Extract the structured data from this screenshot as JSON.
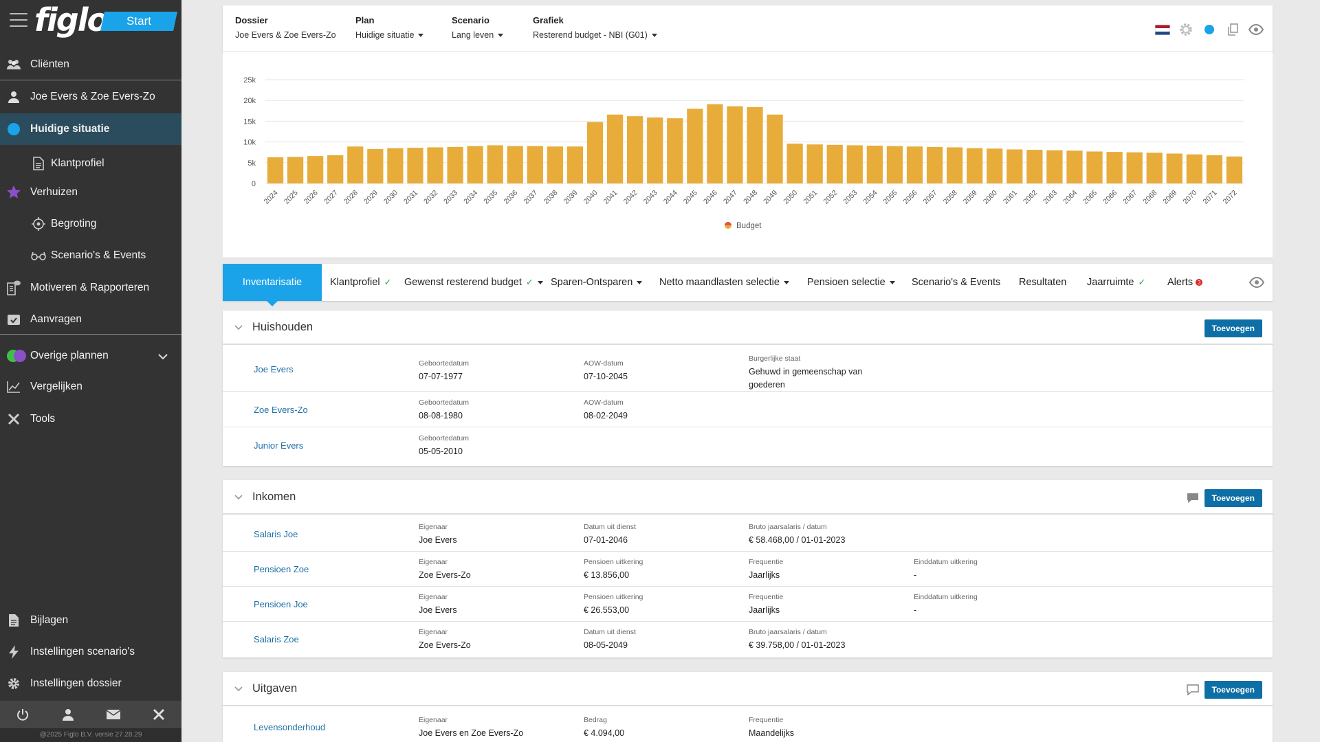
{
  "app": {
    "logo": "figlo",
    "start_label": "Start"
  },
  "sidebar": {
    "items": [
      {
        "label": "Cliënten",
        "icon": "users-icon"
      },
      {
        "label": "Joe Evers & Zoe Evers-Zo",
        "icon": "user-icon"
      },
      {
        "label": "Huidige situatie",
        "icon": "dot-icon"
      },
      {
        "label": "Klantprofiel",
        "icon": "document-icon"
      },
      {
        "label": "Verhuizen",
        "icon": "star-icon"
      },
      {
        "label": "Begroting",
        "icon": "target-icon"
      },
      {
        "label": "Scenario's & Events",
        "icon": "glasses-icon"
      },
      {
        "label": "Motiveren & Rapporteren",
        "icon": "report-icon"
      },
      {
        "label": "Aanvragen",
        "icon": "request-icon"
      },
      {
        "label": "Overige plannen",
        "icon": "plans-icon"
      },
      {
        "label": "Vergelijken",
        "icon": "compare-icon"
      },
      {
        "label": "Tools",
        "icon": "tools-icon"
      },
      {
        "label": "Bijlagen",
        "icon": "attachment-icon"
      },
      {
        "label": "Instellingen scenario's",
        "icon": "bolt-icon"
      },
      {
        "label": "Instellingen dossier",
        "icon": "gear-icon"
      }
    ],
    "copyright": "@2025 Figlo B.V. versie 27.28.29"
  },
  "topbar": {
    "dossier": {
      "label": "Dossier",
      "value": "Joe Evers & Zoe Evers-Zo"
    },
    "plan": {
      "label": "Plan",
      "value": "Huidige situatie"
    },
    "scenario": {
      "label": "Scenario",
      "value": "Lang leven"
    },
    "grafiek": {
      "label": "Grafiek",
      "value": "Resterend budget - NBI (G01)"
    }
  },
  "chart_data": {
    "type": "bar",
    "categories": [
      "2024",
      "2025",
      "2026",
      "2027",
      "2028",
      "2029",
      "2030",
      "2031",
      "2032",
      "2033",
      "2034",
      "2035",
      "2036",
      "2037",
      "2038",
      "2039",
      "2040",
      "2041",
      "2042",
      "2043",
      "2044",
      "2045",
      "2046",
      "2047",
      "2048",
      "2049",
      "2050",
      "2051",
      "2052",
      "2053",
      "2054",
      "2055",
      "2056",
      "2057",
      "2058",
      "2059",
      "2060",
      "2061",
      "2062",
      "2063",
      "2064",
      "2065",
      "2066",
      "2067",
      "2068",
      "2069",
      "2070",
      "2071",
      "2072"
    ],
    "series": [
      {
        "name": "Budget",
        "values": [
          6300,
          6400,
          6600,
          6800,
          8900,
          8300,
          8500,
          8600,
          8700,
          8800,
          9000,
          9200,
          9000,
          9000,
          8900,
          8900,
          14800,
          16600,
          16200,
          15900,
          15700,
          18000,
          19100,
          18600,
          18400,
          16600,
          9600,
          9400,
          9300,
          9200,
          9100,
          9000,
          8900,
          8800,
          8700,
          8500,
          8400,
          8200,
          8100,
          8000,
          7900,
          7700,
          7600,
          7500,
          7400,
          7200,
          7000,
          6800,
          6500
        ]
      }
    ],
    "yticks": [
      "0",
      "5k",
      "10k",
      "15k",
      "20k",
      "25k"
    ],
    "ylim": [
      0,
      25000
    ],
    "color": "#e8ac3a",
    "legend": "bottom"
  },
  "tabs": [
    {
      "label": "Inventarisatie"
    },
    {
      "label": "Klantprofiel",
      "check": "✓"
    },
    {
      "label": "Gewenst resterend budget",
      "check": "✓"
    },
    {
      "label": "Sparen-Ontsparen"
    },
    {
      "label": "Netto maandlasten selectie"
    },
    {
      "label": "Pensioen selectie"
    },
    {
      "label": "Scenario's & Events"
    },
    {
      "label": "Resultaten"
    },
    {
      "label": "Jaarruimte",
      "check": "✓"
    },
    {
      "label": "Alerts",
      "badge": "3"
    }
  ],
  "buttons": {
    "add": "Toevoegen"
  },
  "huishouden": {
    "title": "Huishouden",
    "rows": [
      {
        "name": "Joe Evers",
        "f1l": "Geboortedatum",
        "f1v": "07-07-1977",
        "f2l": "AOW-datum",
        "f2v": "07-10-2045",
        "f3l": "Burgerlijke staat",
        "f3v": "Gehuwd in gemeenschap van goederen"
      },
      {
        "name": "Zoe Evers-Zo",
        "f1l": "Geboortedatum",
        "f1v": "08-08-1980",
        "f2l": "AOW-datum",
        "f2v": "08-02-2049"
      },
      {
        "name": "Junior Evers",
        "f1l": "Geboortedatum",
        "f1v": "05-05-2010"
      }
    ]
  },
  "inkomen": {
    "title": "Inkomen",
    "rows": [
      {
        "name": "Salaris Joe",
        "f1l": "Eigenaar",
        "f1v": "Joe Evers",
        "f2l": "Datum uit dienst",
        "f2v": "07-01-2046",
        "f3l": "Bruto jaarsalaris / datum",
        "f3v": "€ 58.468,00 / 01-01-2023"
      },
      {
        "name": "Pensioen Zoe",
        "f1l": "Eigenaar",
        "f1v": "Zoe Evers-Zo",
        "f2l": "Pensioen uitkering",
        "f2v": "€ 13.856,00",
        "f3l": "Frequentie",
        "f3v": "Jaarlijks",
        "f4l": "Einddatum uitkering",
        "f4v": "-"
      },
      {
        "name": "Pensioen Joe",
        "f1l": "Eigenaar",
        "f1v": "Joe Evers",
        "f2l": "Pensioen uitkering",
        "f2v": "€ 26.553,00",
        "f3l": "Frequentie",
        "f3v": "Jaarlijks",
        "f4l": "Einddatum uitkering",
        "f4v": "-"
      },
      {
        "name": "Salaris Zoe",
        "f1l": "Eigenaar",
        "f1v": "Zoe Evers-Zo",
        "f2l": "Datum uit dienst",
        "f2v": "08-05-2049",
        "f3l": "Bruto jaarsalaris / datum",
        "f3v": "€ 39.758,00 / 01-01-2023"
      }
    ]
  },
  "uitgaven": {
    "title": "Uitgaven",
    "rows": [
      {
        "name": "Levensonderhoud",
        "f1l": "Eigenaar",
        "f1v": "Joe Evers en Zoe Evers-Zo",
        "f2l": "Bedrag",
        "f2v": "€ 4.094,00",
        "f3l": "Frequentie",
        "f3v": "Maandelijks"
      }
    ]
  }
}
